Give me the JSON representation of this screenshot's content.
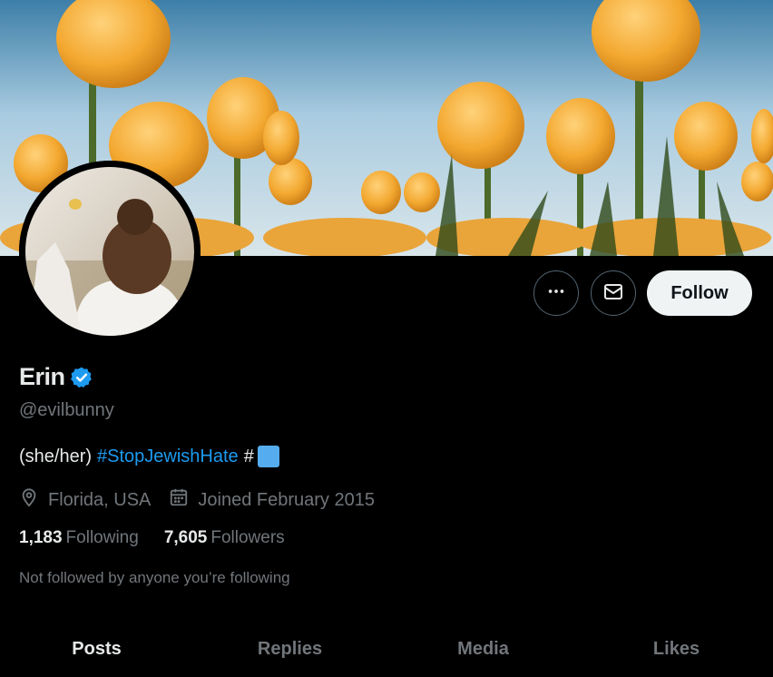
{
  "profile": {
    "name": "Erin",
    "handle": "@evilbunny",
    "bio": {
      "prefix": "(she/her)",
      "hashtag": "#StopJewishHate",
      "suffix": "#"
    },
    "location": "Florida, USA",
    "joined": "Joined February 2015",
    "following_count": "1,183",
    "following_label": "Following",
    "followers_count": "7,605",
    "followers_label": "Followers",
    "not_followed_text": "Not followed by anyone you’re following"
  },
  "actions": {
    "follow_label": "Follow",
    "more_icon": "more-icon",
    "message_icon": "envelope-icon"
  },
  "tabs": [
    {
      "label": "Posts",
      "active": true
    },
    {
      "label": "Replies",
      "active": false
    },
    {
      "label": "Media",
      "active": false
    },
    {
      "label": "Likes",
      "active": false
    }
  ],
  "colors": {
    "accent": "#1d9bf0",
    "background": "#000000",
    "muted": "#71767b"
  }
}
